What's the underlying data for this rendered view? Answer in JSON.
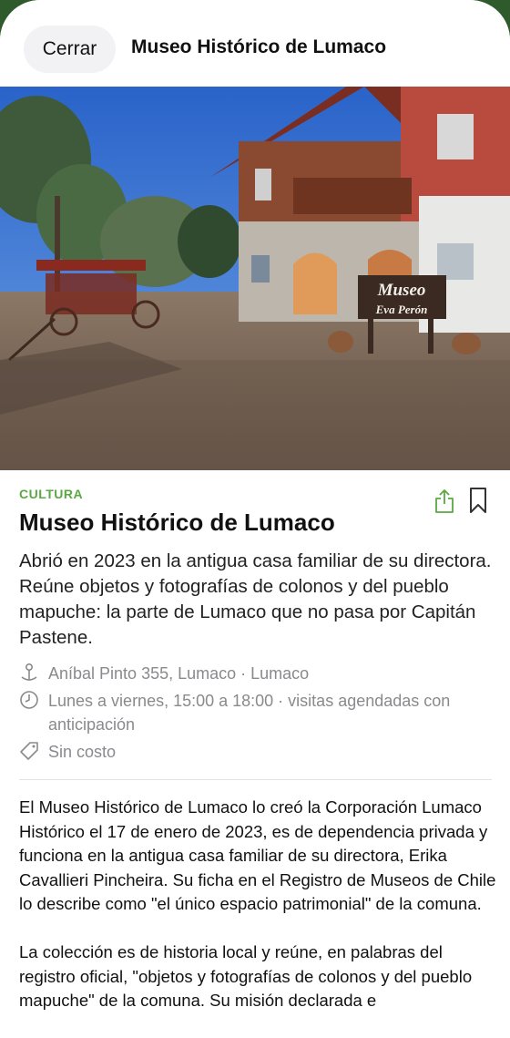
{
  "header": {
    "close_label": "Cerrar",
    "title": "Museo Histórico de Lumaco"
  },
  "hero_image": {
    "sign_line1": "Museo",
    "sign_line2": "Eva Perón"
  },
  "place": {
    "category": "CULTURA",
    "title": "Museo Histórico de Lumaco",
    "summary": "Abrió en 2023 en la antigua casa familiar de su directora. Reúne objetos y fotografías de colonos y del pueblo mapuche: la parte de Lumaco que no pasa por Capitán Pastene.",
    "address": "Aníbal Pinto 355, Lumaco · Lumaco",
    "hours": "Lunes a viernes, 15:00 a 18:00 · visitas agendadas con anticipación",
    "price": "Sin costo"
  },
  "body": {
    "paragraph1": "El Museo Histórico de Lumaco lo creó la Corporación Lumaco Histórico el 17 de enero de 2023, es de dependencia privada y funciona en la antigua casa familiar de su directora, Erika Cavallieri Pincheira. Su ficha en el Registro de Museos de Chile lo describe como \"el único espacio patrimonial\" de la comuna.",
    "paragraph2": "La colección es de historia local y reúne, en palabras del registro oficial, \"objetos y fotografías de colonos y del pueblo mapuche\" de la comuna. Su misión declarada e"
  },
  "colors": {
    "accent": "#5aa844",
    "background_edge": "#2f5a2c",
    "muted_text": "#8a8a8e"
  },
  "icons": {
    "share": "share-icon",
    "bookmark": "bookmark-icon",
    "location": "location-pin-icon",
    "clock": "clock-icon",
    "tag": "price-tag-icon"
  }
}
